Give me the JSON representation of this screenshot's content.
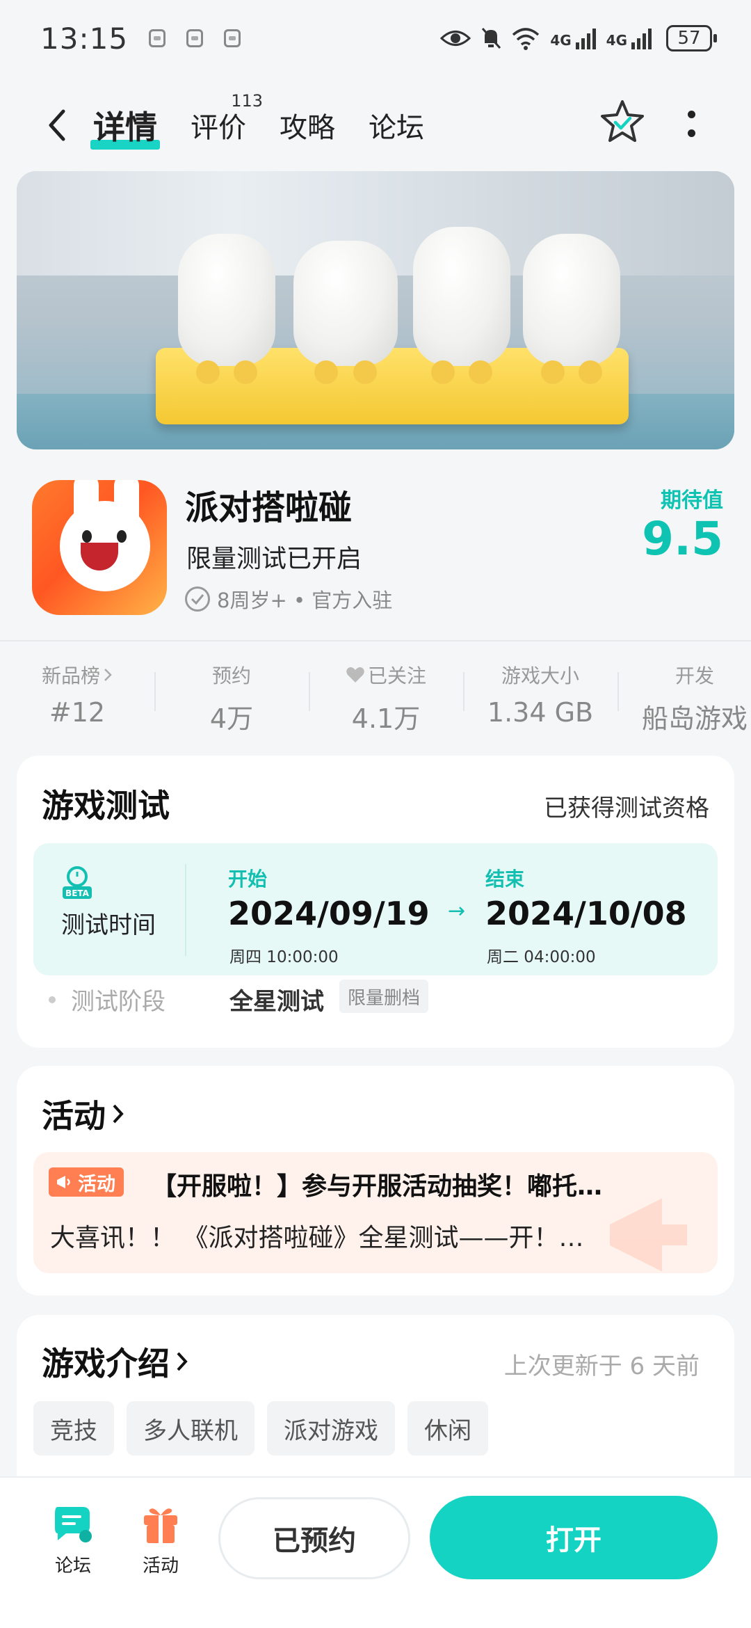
{
  "status_bar": {
    "time": "13:15",
    "network_1": "4G",
    "network_2": "4G",
    "battery": "57"
  },
  "header": {
    "tabs": [
      {
        "label": "详情",
        "active": true
      },
      {
        "label": "评价",
        "badge": "113"
      },
      {
        "label": "攻略"
      },
      {
        "label": "论坛"
      }
    ]
  },
  "game": {
    "title": "派对搭啦碰",
    "subtitle": "限量测试已开启",
    "meta": "8周岁+ • 官方入驻",
    "rating_label": "期待值",
    "rating_value": "9.5"
  },
  "stats": [
    {
      "label": "新品榜",
      "value": "#12"
    },
    {
      "label": "预约",
      "value": "4万"
    },
    {
      "label": "已关注",
      "value": "4.1万"
    },
    {
      "label": "游戏大小",
      "value": "1.34 GB"
    },
    {
      "label": "开发",
      "value": "船岛游戏"
    }
  ],
  "test": {
    "title": "游戏测试",
    "qualify": "已获得测试资格",
    "time_label": "测试时间",
    "start_label": "开始",
    "start_date": "2024/09/19",
    "start_week": "周四  10:00:00",
    "end_label": "结束",
    "end_date": "2024/10/08",
    "end_week": "周二  04:00:00",
    "arrow": "→",
    "stage_label": "测试阶段",
    "stage_value": "全星测试",
    "stage_tag": "限量删档"
  },
  "activity": {
    "title": "活动",
    "tag": "活动",
    "item_title": "【开服啦！】参与开服活动抽奖！嘟托…",
    "item_desc": "大喜讯！！ 《派对搭啦碰》全星测试——开！…"
  },
  "intro": {
    "title": "游戏介绍",
    "update": "上次更新于 6 天前",
    "tags": [
      "竞技",
      "多人联机",
      "派对游戏",
      "休闲"
    ]
  },
  "bottom": {
    "forum_label": "论坛",
    "activity_label": "活动",
    "reserved": "已预约",
    "open": "打开"
  },
  "colors": {
    "accent": "#14d3c2",
    "activity_tag": "#ff7e52",
    "test_box": "#e6f9f7"
  }
}
